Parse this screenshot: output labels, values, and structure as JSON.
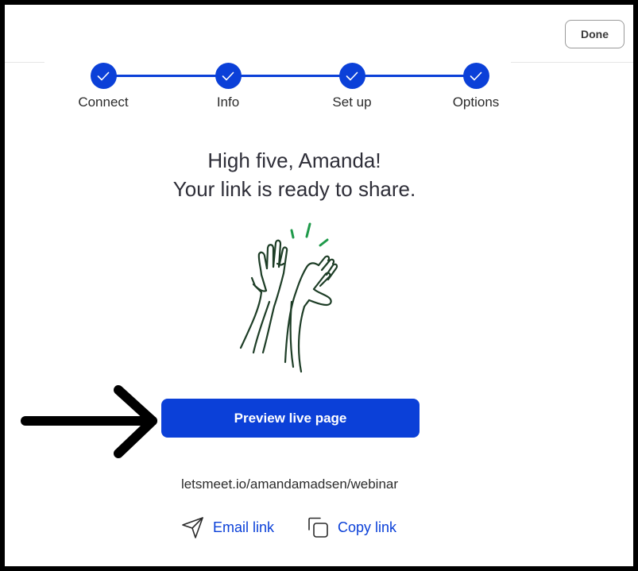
{
  "header": {
    "done_label": "Done"
  },
  "stepper": {
    "steps": [
      {
        "label": "Connect",
        "completed": true
      },
      {
        "label": "Info",
        "completed": true
      },
      {
        "label": "Set up",
        "completed": true
      },
      {
        "label": "Options",
        "completed": true
      }
    ],
    "accent_color": "#0b40d8"
  },
  "main": {
    "headline_line1": "High five, Amanda!",
    "headline_line2": "Your link is ready to share.",
    "preview_button_label": "Preview live page",
    "link_url": "letsmeet.io/amandamadsen/webinar",
    "email_link_label": "Email link",
    "copy_link_label": "Copy link"
  },
  "icons": {
    "illustration": "high-five-hands-illustration",
    "email": "paper-plane-icon",
    "copy": "copy-icon",
    "step": "check-icon",
    "annotation": "arrow-right-icon"
  }
}
